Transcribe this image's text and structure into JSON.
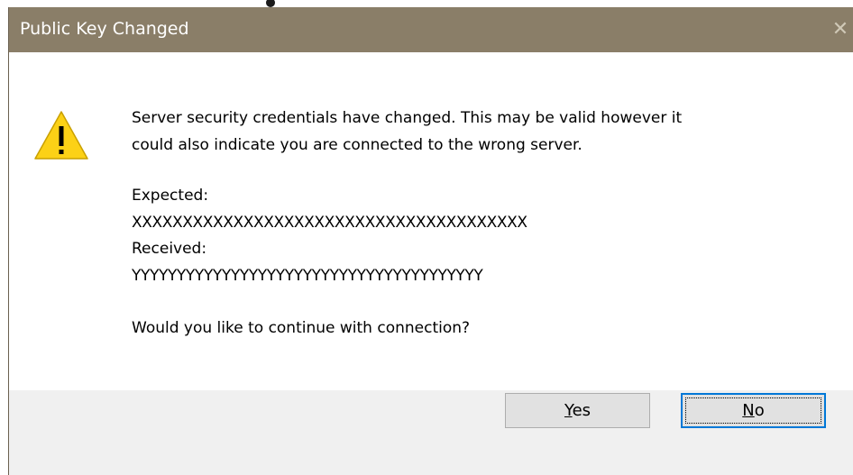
{
  "dialog": {
    "title": "Public Key Changed",
    "close_glyph": "✕",
    "icon": "warning-icon",
    "message_line1": "Server security credentials have changed. This may be valid however it",
    "message_line2": "could also indicate you are connected to the wrong server.",
    "expected_label": "Expected:",
    "expected_value": "XXXXXXXXXXXXXXXXXXXXXXXXXXXXXXXXXXXXXXX",
    "received_label": "Received:",
    "received_value": "YYYYYYYYYYYYYYYYYYYYYYYYYYYYYYYYYYYYYYY",
    "question": "Would you like to continue with connection?",
    "buttons": {
      "yes": {
        "accel": "Y",
        "rest": "es"
      },
      "no": {
        "accel": "N",
        "rest": "o"
      }
    },
    "colors": {
      "titlebar": "#8a7e68",
      "footer": "#f0f0f0",
      "button_face": "#e1e1e1",
      "focus_border": "#0078d7",
      "warning_fill": "#fcd116"
    }
  }
}
